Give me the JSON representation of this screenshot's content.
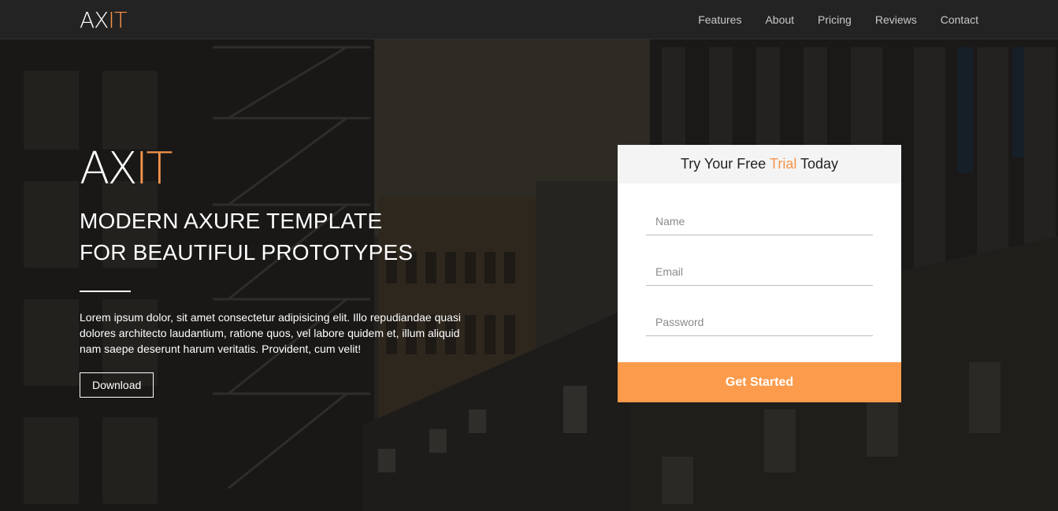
{
  "brand": {
    "prefix": "AX",
    "accent": "IT"
  },
  "nav": {
    "items": [
      "Features",
      "About",
      "Pricing",
      "Reviews",
      "Contact"
    ]
  },
  "hero": {
    "logo_prefix": "AX",
    "logo_accent": "IT",
    "title_line1": "MODERN AXURE TEMPLATE",
    "title_line2": "FOR BEAUTIFUL PROTOTYPES",
    "text": "Lorem ipsum dolor, sit amet consectetur adipisicing elit. Illo repudiandae quasi dolores architecto laudantium, ratione quos, vel labore quidem et, illum aliquid nam saepe deserunt harum veritatis. Provident, cum velit!",
    "download_label": "Download"
  },
  "form": {
    "header_pre": "Try Your Free ",
    "header_accent": "Trial",
    "header_post": " Today",
    "name_placeholder": "Name",
    "email_placeholder": "Email",
    "password_placeholder": "Password",
    "submit_label": "Get Started"
  },
  "colors": {
    "accent": "#f7944a",
    "button": "#fc9b4c",
    "navbar": "#232323"
  }
}
